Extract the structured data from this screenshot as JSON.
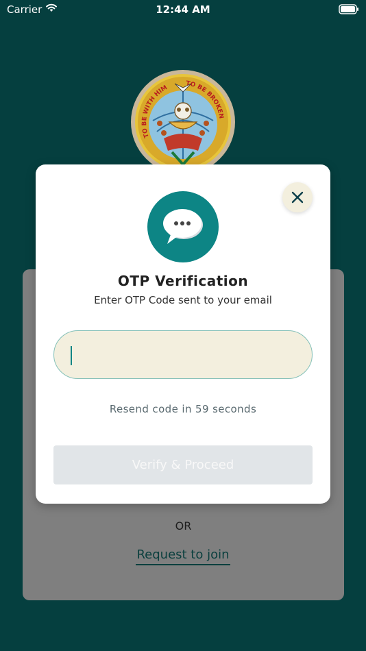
{
  "status_bar": {
    "carrier": "Carrier",
    "time": "12:44 AM",
    "icons": [
      "wifi-icon",
      "battery-icon"
    ]
  },
  "logo": {
    "text_top_left": "TO BE WITH HIM",
    "text_top_right": "TO BE BROKEN"
  },
  "background": {
    "or_text": "OR",
    "request_join_link": "Request to join"
  },
  "modal": {
    "title": "OTP Verification",
    "subtitle": "Enter OTP Code sent to your email",
    "otp_input": {
      "value": "",
      "placeholder": ""
    },
    "resend_text": "Resend code in 59 seconds",
    "verify_button": "Verify & Proceed",
    "icons": [
      "chat-bubble-icon",
      "close-icon"
    ]
  },
  "colors": {
    "background": "#053f3f",
    "accent": "#0d8585",
    "input_fill": "#f3efde",
    "disabled_button": "#e1e5e8"
  }
}
